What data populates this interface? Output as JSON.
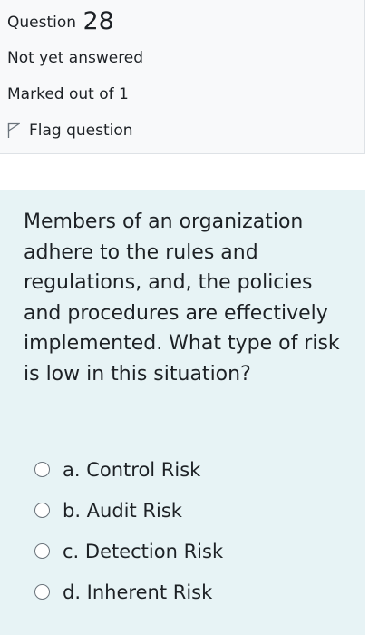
{
  "info": {
    "question_label": "Question",
    "question_number": "28",
    "state": "Not yet answered",
    "grade": "Marked out of 1",
    "flag_label": "Flag question"
  },
  "question": {
    "text": "Members of an organization adhere to the rules and regulations, and, the policies and procedures are effectively implemented. What type of risk is low in this situation?",
    "answers": [
      {
        "label": "a. Control Risk"
      },
      {
        "label": "b. Audit Risk"
      },
      {
        "label": "c. Detection Risk"
      },
      {
        "label": "d. Inherent Risk"
      }
    ]
  },
  "icons": {
    "flag": "flag-outline-icon",
    "radio": "radio-unchecked-icon"
  },
  "colors": {
    "info_bg": "#f8f9fa",
    "content_bg": "#e7f3f5",
    "text": "#1d2125"
  }
}
